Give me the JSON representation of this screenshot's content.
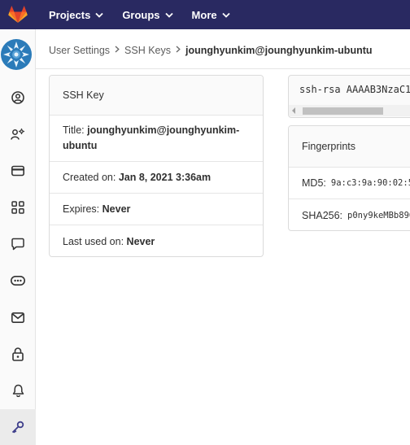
{
  "nav": {
    "projects": "Projects",
    "groups": "Groups",
    "more": "More"
  },
  "sidebar": {
    "icons": [
      "profile-icon",
      "account-icon",
      "billing-icon",
      "applications-icon",
      "chat-icon",
      "access-tokens-icon",
      "emails-icon",
      "password-icon",
      "notifications-icon",
      "ssh-keys-icon"
    ],
    "active": "ssh-keys-icon"
  },
  "breadcrumb": {
    "item1": "User Settings",
    "item2": "SSH Keys",
    "current": "jounghyunkim@jounghyunkim-ubuntu"
  },
  "ssh_key_card": {
    "header": "SSH Key",
    "title_label": "Title:",
    "title_value_line1": "jounghyunkim@jounghyunkim-",
    "title_value_line2": "ubuntu",
    "created_label": "Created on:",
    "created_value": "Jan 8, 2021 3:36am",
    "expires_label": "Expires:",
    "expires_value": "Never",
    "last_used_label": "Last used on:",
    "last_used_value": "Never"
  },
  "key_content": "ssh-rsa AAAAB3NzaC1",
  "fingerprints": {
    "header": "Fingerprints",
    "md5_label": "MD5:",
    "md5_value": "9a:c3:9a:90:02:5",
    "sha256_label": "SHA256:",
    "sha256_value": "p0ny9keMBb896"
  },
  "colors": {
    "navbar": "#292961",
    "accent": "#6666c4",
    "logo_orange": "#e24329"
  }
}
